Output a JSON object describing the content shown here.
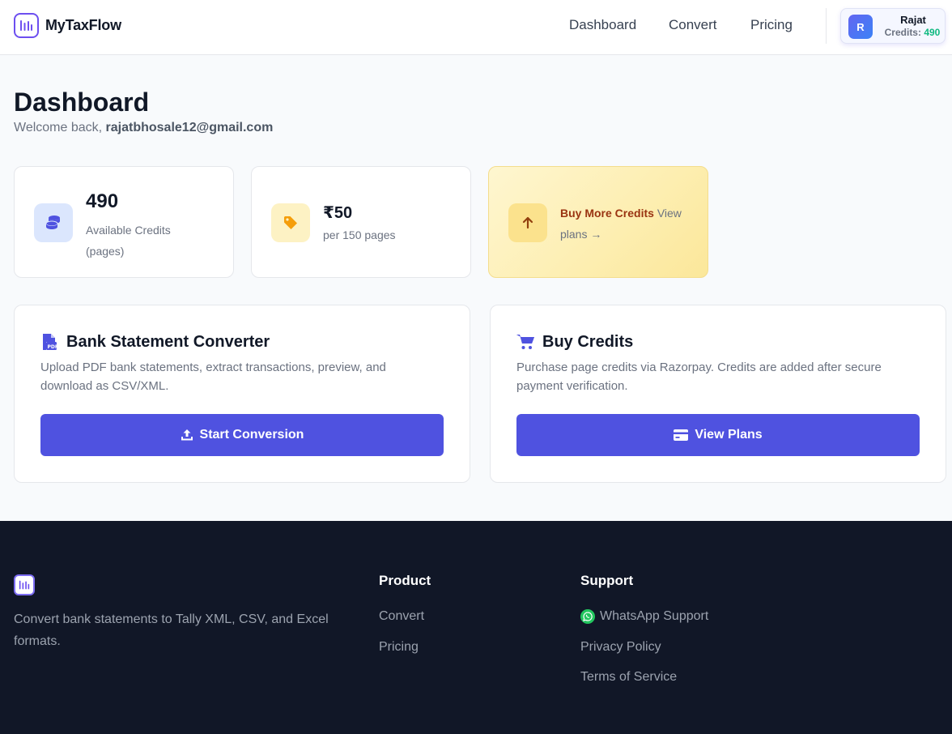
{
  "header": {
    "brand": "MyTaxFlow",
    "nav": [
      "Dashboard",
      "Convert",
      "Pricing"
    ],
    "user": {
      "initial": "R",
      "name": "Rajat",
      "credits_label": "Credits:",
      "credits_value": "490"
    }
  },
  "page": {
    "title": "Dashboard",
    "welcome_prefix": "Welcome back,",
    "email": "rajatbhosale12@gmail.com"
  },
  "stats": {
    "credits": {
      "value": "490",
      "label": "Available Credits (pages)",
      "icon": "coins-icon"
    },
    "price": {
      "value": "₹50",
      "label": "per 150 pages",
      "icon": "tag-icon"
    },
    "buy": {
      "strong": "Buy More Credits",
      "rest": "View plans →",
      "icon": "arrow-up-icon"
    }
  },
  "features": {
    "converter": {
      "title": "Bank Statement Converter",
      "description": "Upload PDF bank statements, extract transactions, preview, and download as CSV/XML.",
      "button": "Start Conversion",
      "icon": "pdf-file-icon",
      "button_icon": "upload-icon"
    },
    "buy": {
      "title": "Buy Credits",
      "description": "Purchase page credits via Razorpay. Credits are added after secure payment verification.",
      "button": "View Plans",
      "icon": "cart-icon",
      "button_icon": "credit-card-icon"
    }
  },
  "footer": {
    "tagline": "Convert bank statements to Tally XML, CSV, and Excel formats.",
    "product": {
      "heading": "Product",
      "links": [
        "Convert",
        "Pricing"
      ]
    },
    "support": {
      "heading": "Support",
      "links": [
        "WhatsApp Support",
        "Privacy Policy",
        "Terms of Service"
      ]
    }
  },
  "colors": {
    "primary": "#4f52e0",
    "brand_purple": "#6d4ff0",
    "credits_green": "#10b981",
    "footer_bg": "#111727",
    "buy_card_bg": "#fdeeb0"
  }
}
